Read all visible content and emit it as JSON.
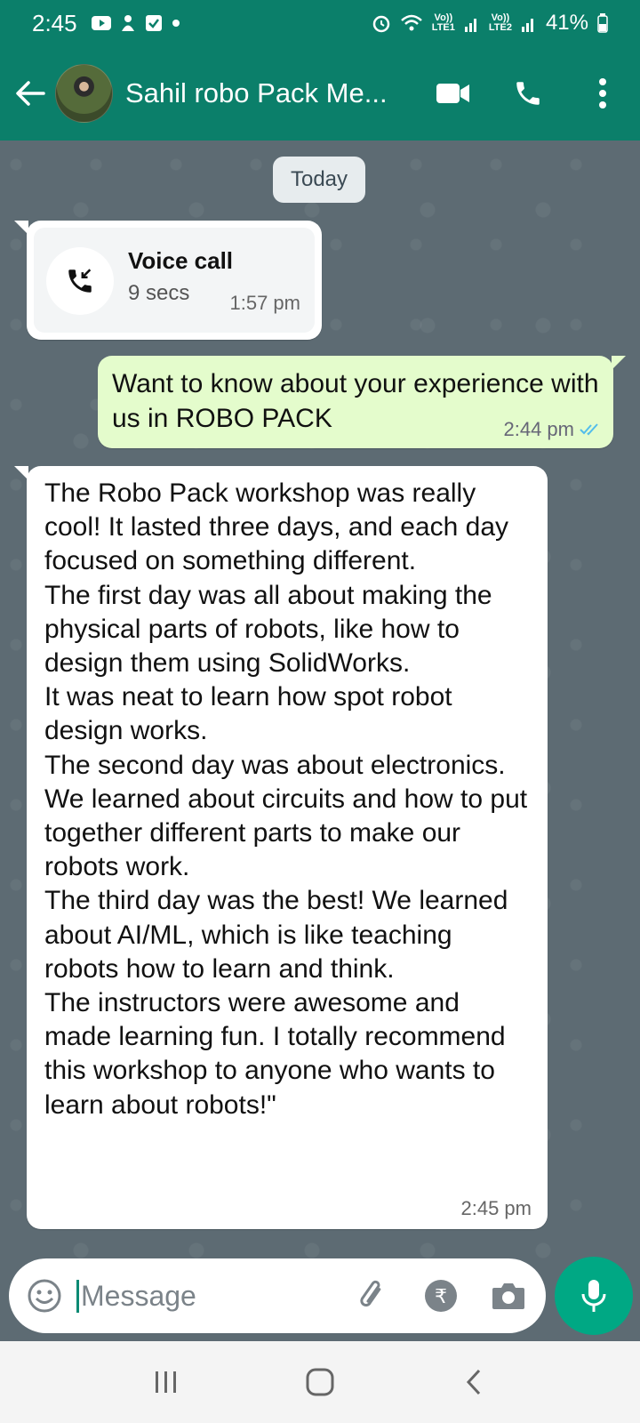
{
  "status_bar": {
    "time": "2:45",
    "lte1": "LTE1",
    "lte2": "LTE2",
    "vo1": "Vo))",
    "vo2": "Vo))",
    "battery": "41%"
  },
  "header": {
    "contact_name": "Sahil robo Pack Me...",
    "icons": [
      "back-arrow-icon",
      "video-call-icon",
      "phone-icon",
      "more-vert-icon"
    ]
  },
  "chat": {
    "date_chip": "Today",
    "call": {
      "title": "Voice call",
      "duration": "9 secs",
      "time": "1:57 pm"
    },
    "outgoing": {
      "text": "Want to know about your experience with us in ROBO PACK",
      "time": "2:44 pm",
      "status": "read"
    },
    "incoming": {
      "text": "The Robo Pack workshop was really cool! It lasted three days, and each day focused on something different.\nThe first day was all about making the physical parts of robots, like how to design them using SolidWorks.\nIt was neat to learn how spot robot design works.\nThe second day was about electronics. We learned about circuits and how to put together different parts to make our robots work.\nThe third day was the best! We learned about AI/ML, which is like teaching robots how to learn and think.\nThe instructors were awesome and made learning fun. I totally recommend this workshop to anyone who wants to learn about robots!\"",
      "time": "2:45 pm"
    }
  },
  "composer": {
    "placeholder": "Message"
  },
  "colors": {
    "header": "#0b7f6a",
    "outgoing_bubble": "#e4fccc",
    "incoming_bubble": "#ffffff",
    "mic_button": "#00a884",
    "read_ticks": "#53bdeb"
  }
}
